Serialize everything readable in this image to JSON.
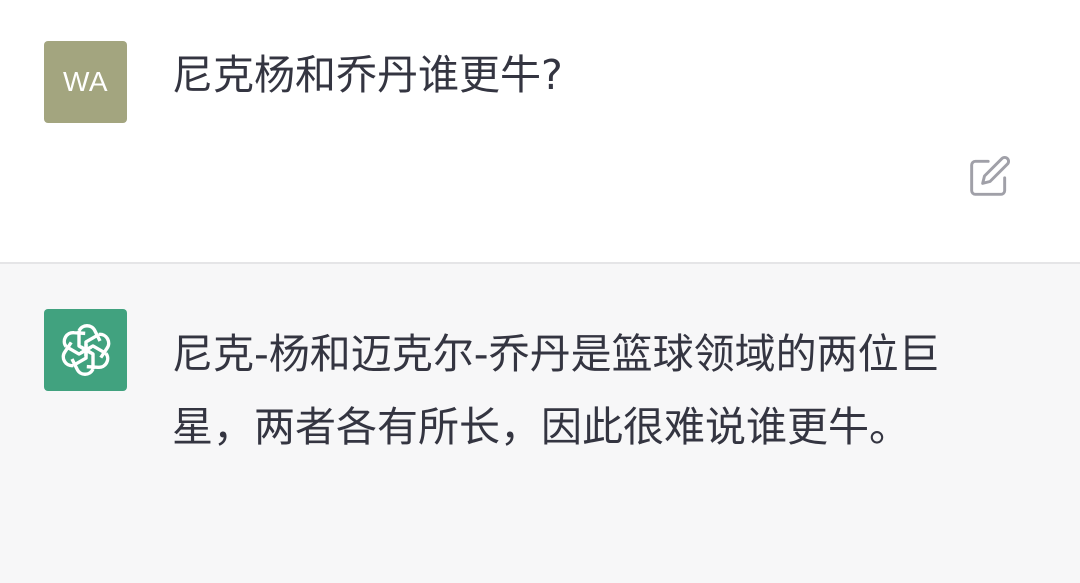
{
  "user_message": {
    "avatar_initials": "WA",
    "avatar_color": "#a3a57f",
    "text": "尼克杨和乔丹谁更牛?",
    "edit_icon": "edit-icon"
  },
  "assistant_message": {
    "avatar_icon": "openai-logo-icon",
    "avatar_color": "#41a27f",
    "text": "尼克-杨和迈克尔-乔丹是篮球领域的两位巨星，两者各有所长，因此很难说谁更牛。"
  }
}
